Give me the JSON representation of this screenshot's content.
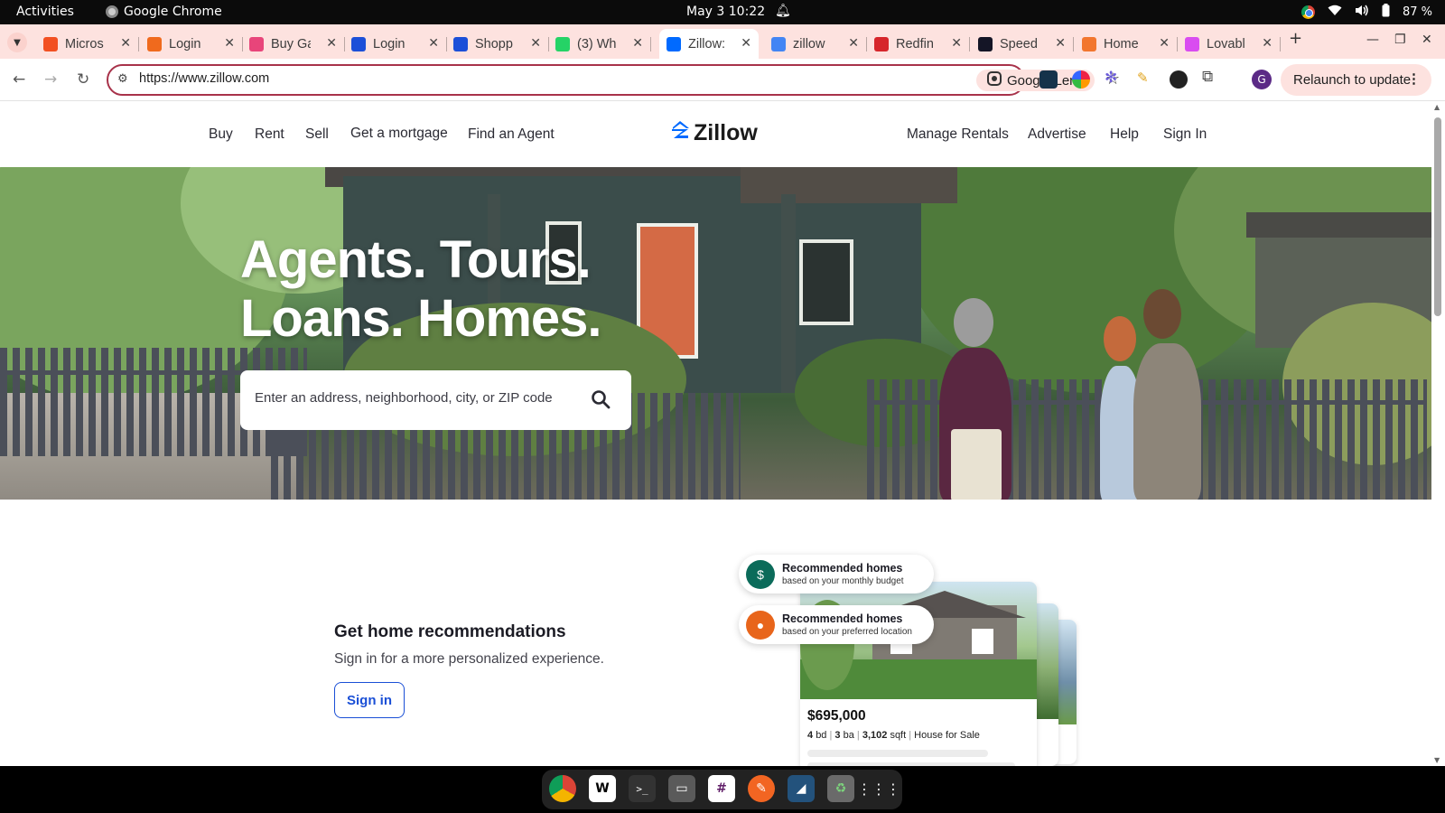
{
  "system_bar": {
    "activities": "Activities",
    "app_name": "Google Chrome",
    "clock": "May 3  10:22",
    "battery": "87 %"
  },
  "tabs": [
    {
      "title": "Micros",
      "favicon": "microsoft-logo",
      "color": "#f25022"
    },
    {
      "title": "Login",
      "favicon": "g-logo",
      "color": "#f06a1d"
    },
    {
      "title": "Buy Ga",
      "favicon": "pinwheel-logo",
      "color": "#e8457a"
    },
    {
      "title": "Login",
      "favicon": "w-logo",
      "color": "#1b4fd8"
    },
    {
      "title": "Shopp",
      "favicon": "w-logo",
      "color": "#1b4fd8"
    },
    {
      "title": "(3) Wh",
      "favicon": "whatsapp-logo",
      "color": "#25d366"
    },
    {
      "title": "Zillow:",
      "favicon": "zillow-logo",
      "color": "#006aff",
      "active": true
    },
    {
      "title": "zillow",
      "favicon": "google-logo",
      "color": "#4285f4"
    },
    {
      "title": "Redfin",
      "favicon": "redfin-logo",
      "color": "#d6262b"
    },
    {
      "title": "Speed",
      "favicon": "speedtest-logo",
      "color": "#141526"
    },
    {
      "title": "Home",
      "favicon": "home-logo",
      "color": "#f2762e"
    },
    {
      "title": "Lovabl",
      "favicon": "lovable-logo",
      "color": "#d94cf0"
    }
  ],
  "toolbar": {
    "url": "https://www.zillow.com",
    "lens_label": "Google Lens",
    "relaunch_label": "Relaunch to update",
    "profile_initial": "G"
  },
  "zillow": {
    "nav_left": [
      "Buy",
      "Rent",
      "Sell",
      "Get a mortgage",
      "Find an Agent"
    ],
    "logo_text": "Zillow",
    "nav_right": [
      "Manage Rentals",
      "Advertise",
      "Help",
      "Sign In"
    ],
    "hero": {
      "line1": "Agents. Tours.",
      "line2": "Loans. Homes.",
      "search_placeholder": "Enter an address, neighborhood, city, or ZIP code"
    },
    "recommendations": {
      "title": "Get home recommendations",
      "subtitle": "Sign in for a more personalized experience.",
      "button": "Sign in",
      "pill1_title": "Recommended homes",
      "pill1_sub": "based on your monthly budget",
      "pill2_title": "Recommended homes",
      "pill2_sub": "based on your preferred location",
      "card": {
        "price": "$695,000",
        "beds": "4",
        "beds_unit": "bd",
        "baths": "3",
        "baths_unit": "ba",
        "sqft": "3,102",
        "sqft_unit": "sqft",
        "type": "House for Sale"
      }
    }
  },
  "colors": {
    "zillow_blue": "#006aff",
    "sign_in_blue": "#1a4fd6",
    "tab_strip": "#fde2df",
    "omnibox_border": "#a8324a"
  }
}
